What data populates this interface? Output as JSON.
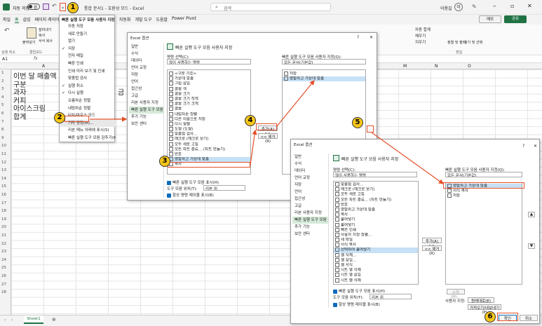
{
  "titlebar": {
    "autosave_label": "자동 저장",
    "toggle_label": "끔",
    "doc_title": "통합 문서1 - 호환성 모드 - Excel",
    "search_placeholder": "검색",
    "user": "이용길",
    "user_initials": "이"
  },
  "ribbon_tabs": [
    "파일",
    "홈",
    "삽입",
    "페이지 레이아웃",
    "수식",
    "데이터",
    "검토",
    "보기",
    "자동화",
    "개발 도구",
    "도움말",
    "Power Pivot"
  ],
  "ribbon_right": {
    "memo": "메모",
    "share": "공유"
  },
  "ribbon_groups": {
    "undo": "실행 취소",
    "clipboard": "클립보드",
    "paste": "붙여넣기",
    "cut": "잘라내기",
    "copy": "복사",
    "format_painter": "서식 복사",
    "autosum": "자동 합계",
    "fill": "채우기",
    "clear": "지우기",
    "sort_filter": "정렬 및 필터",
    "find_select": "찾기 및 선택",
    "edit": "편집"
  },
  "formula_bar": {
    "namebox": "A1",
    "fx": "fx"
  },
  "sheet": {
    "columns": [
      "A",
      "M",
      "N",
      "O"
    ],
    "rows": [
      "1",
      "2",
      "3",
      "4",
      "5",
      "6",
      "7",
      "8",
      "9",
      "10",
      "11",
      "12",
      "13",
      "14",
      "15",
      "16",
      "17",
      "18",
      "19",
      "20",
      "21",
      "22",
      "23",
      "24",
      "25",
      "26",
      "27",
      "28"
    ],
    "cells": [
      "이번 달 매출액",
      "구분",
      "과자",
      "커피",
      "아이스크림",
      "합계"
    ],
    "cut_text": "금",
    "tab": "Sheet1",
    "add_sheet": "⊕"
  },
  "qat_menu": {
    "title": "빠른 실행 도구 모음 사용자 지정",
    "items": [
      "자동 저장",
      "새로 만들기",
      "열기",
      "저장",
      "전자 메일",
      "빠른 인쇄",
      "인쇄 미리 보기 및 인쇄",
      "맞춤법 검사",
      "실행 취소",
      "다시 실행",
      "오름차순 정렬",
      "내림차순 정렬",
      "터치/마우스 모드",
      "기타 명령(M)...",
      "리본 메뉴 아래에 표시(S)",
      "빠른 실행 도구 모음 감추기(H)"
    ],
    "checked": [
      false,
      false,
      false,
      true,
      false,
      false,
      false,
      false,
      true,
      true,
      false,
      false,
      false,
      false,
      false,
      false
    ]
  },
  "dialog1": {
    "title": "Excel 옵션",
    "help": "?",
    "close": "✕",
    "nav": [
      "일반",
      "수식",
      "데이터",
      "언어 교정",
      "저장",
      "언어",
      "접근성",
      "고급",
      "리본 사용자 지정",
      "빠른 실행 도구 모음",
      "추가 기능",
      "보안 센터"
    ],
    "heading": "빠른 실행 도구 모음 사용자 지정",
    "choose_label": "명령 선택(C):",
    "choose_value": "많이 사용하는 명령",
    "customize_label": "빠른 실행 도구 모음 사용자 지정(Q):",
    "customize_value": "모든 문서(기본값)",
    "commands": [
      "<구분 기호>",
      "가운데 맞춤",
      "그림 삽입",
      "글꼴 색",
      "글꼴 크기",
      "글꼴 크기 작게",
      "글꼴 크기 크게",
      "글꼴",
      "내림차순 정렬",
      "다른 이름으로 저장",
      "다시 실행",
      "도형 (도형)",
      "맞춤법 검사...",
      "매크로 (매크로 보기)",
      "모두 새로 고침",
      "모든 차트 종류... (차트 만들기)",
      "번호",
      "병합하고 가운데 맞춤",
      "복사"
    ],
    "right_list": [
      "저장",
      "병합하고 가운데 맞춤"
    ],
    "add": "추가(A) >>",
    "remove": "<< 제거(R)",
    "show_below": "빠른 실행 도구 모음 표시(H)",
    "position_label": "도구 모음 위치(T):",
    "position_value": "리본 위",
    "always_show": "항상 명령 레이블 표시(B)"
  },
  "dialog2": {
    "title": "Excel 옵션",
    "help": "?",
    "close": "✕",
    "nav": [
      "일반",
      "수식",
      "데이터",
      "언어 교정",
      "저장",
      "언어",
      "접근성",
      "고급",
      "리본 사용자 지정",
      "빠른 실행 도구 모음",
      "추가 기능",
      "보안 센터"
    ],
    "heading": "빠른 실행 도구 모음 사용자 지정",
    "choose_label": "명령 선택(C):",
    "choose_value": "많이 사용하는 명령",
    "customize_label": "빠른 실행 도구 모음 사용자 지정(Q):",
    "customize_value": "모든 문서(기본값)",
    "commands": [
      "맞춤법 검사...",
      "매크로 (매크로 보기)",
      "모두 새로 고침",
      "모든 차트 종류... (차트 만들기)",
      "번호",
      "병합하고 가운데 맞춤",
      "복사",
      "붙여넣기",
      "붙여넣기",
      "빠른 인쇄",
      "사용자 지정 정렬...",
      "새 파일",
      "서식 복사",
      "선택하여 붙여넣기",
      "셀 삭제...",
      "셀 삽입...",
      "셀 서식",
      "시트 열 삭제",
      "시트 열 삽입",
      "시트 행 삭제"
    ],
    "right_list": [
      "병합하고 가운데 맞춤",
      "서식 복사",
      "저장"
    ],
    "add": "추가(A) >>",
    "remove": "<< 제거(R)",
    "modify": "수정(M)...",
    "user_settings": "사용자 지정:",
    "reset": "원래대로(E)",
    "import_export": "가져오기/내보내기(P)",
    "show_below": "빠른 실행 도구 모음 표시(H)",
    "position_label": "도구 모음 위치(T):",
    "position_value": "리본 위",
    "always_show": "항상 명령 레이블 표시(B)",
    "ok": "확인",
    "cancel": "취소"
  },
  "steps": [
    "1",
    "2",
    "3",
    "4",
    "5",
    "6"
  ],
  "colors": {
    "excel_green": "#217346",
    "selection": "#e1f0e6",
    "highlight": "#c6e0f5",
    "annotation": "#e5502a",
    "badge": "#f5c518"
  }
}
